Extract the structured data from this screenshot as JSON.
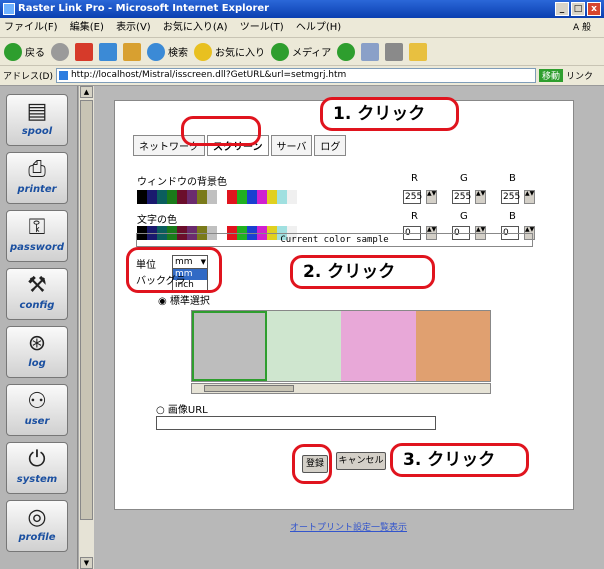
{
  "window": {
    "title": "Raster Link Pro - Microsoft Internet Explorer",
    "controls": [
      "_",
      "□",
      "x"
    ]
  },
  "menubar": {
    "items": [
      "ファイル(F)",
      "編集(E)",
      "表示(V)",
      "お気に入り(A)",
      "ツール(T)",
      "ヘルプ(H)"
    ],
    "tray": "A 般"
  },
  "toolbar": {
    "back": "戻る",
    "search": "検索",
    "favorites": "お気に入り",
    "media": "メディア"
  },
  "addressbar": {
    "label": "アドレス(D)",
    "url": "http://localhost/Mistral/isscreen.dll?GetURL&url=setmgrj.htm",
    "go": "移動",
    "links": "リンク"
  },
  "sidebar": {
    "items": [
      {
        "icon": "spool-icon",
        "label": "spool"
      },
      {
        "icon": "printer-icon",
        "label": "printer"
      },
      {
        "icon": "key-icon",
        "label": "password"
      },
      {
        "icon": "tools-icon",
        "label": "config"
      },
      {
        "icon": "log-icon",
        "label": "log"
      },
      {
        "icon": "user-icon",
        "label": "user"
      },
      {
        "icon": "power-icon",
        "label": "system"
      },
      {
        "icon": "target-icon",
        "label": "profile"
      }
    ]
  },
  "tabs": [
    "ネットワーク",
    "スクリーン",
    "サーバ",
    "ログ"
  ],
  "background_color": {
    "label": "ウィンドウの背景色",
    "r_label": "R",
    "g_label": "G",
    "b_label": "B",
    "r": "255",
    "g": "255",
    "b": "255"
  },
  "text_color": {
    "label": "文字の色",
    "r_label": "R",
    "g_label": "G",
    "b_label": "B",
    "r": "0",
    "g": "0",
    "b": "0"
  },
  "swatch_colors": [
    "#000000",
    "#1a1a6e",
    "#0b5e5e",
    "#1a7a1a",
    "#6b0e2b",
    "#6b2b6e",
    "#7a7a1a",
    "#c0c0c0",
    "#ffffff",
    "#e0141e",
    "#20b020",
    "#1a40d0",
    "#d020d0",
    "#e0d020",
    "#a0e0e0",
    "#f0f0f0",
    "#ffffff",
    "#ffffff"
  ],
  "sample": "Current color sample",
  "unit": {
    "label": "単位",
    "value": "mm",
    "options": [
      "mm",
      "inch"
    ],
    "selected": "mm"
  },
  "background_label": "バックグラ",
  "standard_label": "標準選択",
  "textures": [
    "#bdbdbd",
    "#cfe6cf",
    "#e8a8d8",
    "#e0a070"
  ],
  "image_url_label": "画像URL",
  "buttons": {
    "register": "登録",
    "cancel": "キャンセル"
  },
  "callouts": [
    "1. クリック",
    "2. クリック",
    "3. クリック"
  ],
  "footer_link": "オートプリント設定一覧表示"
}
